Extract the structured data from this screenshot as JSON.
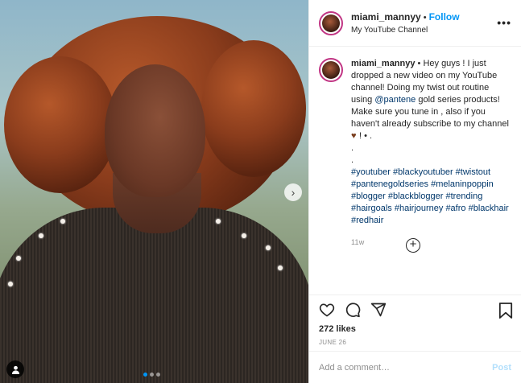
{
  "post": {
    "username": "miami_mannyy",
    "follow_label": "Follow",
    "subtitle": "My YouTube Channel",
    "more_label": "•••",
    "caption": {
      "username": "miami_mannyy",
      "text_part1": " • Hey guys ! I just dropped a new video on my YouTube channel! Doing my twist out routine using ",
      "mention": "@pantene",
      "text_part2": " gold series products! Make sure you tune in , also if you haven't already subscribe to my channel ",
      "text_part3": "! • .",
      "dot1": ".",
      "dot2": ".",
      "hashtags": [
        "#youtuber",
        "#blackyoutuber",
        "#twistout",
        "#pantenegoldseries",
        "#melaninpoppin",
        "#blogger",
        "#blackblogger",
        "#trending",
        "#hairgoals",
        "#hairjourney",
        "#afro",
        "#blackhair",
        "#redhair"
      ]
    },
    "age": "11w",
    "likes": "272 likes",
    "date": "JUNE 26",
    "comment_placeholder": "Add a comment…",
    "post_button": "Post",
    "icons": {
      "like": "heart-icon",
      "comment": "comment-icon",
      "share": "share-icon",
      "save": "bookmark-icon",
      "tagged": "user-icon",
      "next": "chevron-right-icon",
      "add": "plus-circle-icon"
    },
    "colors": {
      "accent": "#0095f6",
      "link": "#00376b",
      "muted": "#8e8e8e",
      "post_disabled": "#b2dffc"
    }
  }
}
